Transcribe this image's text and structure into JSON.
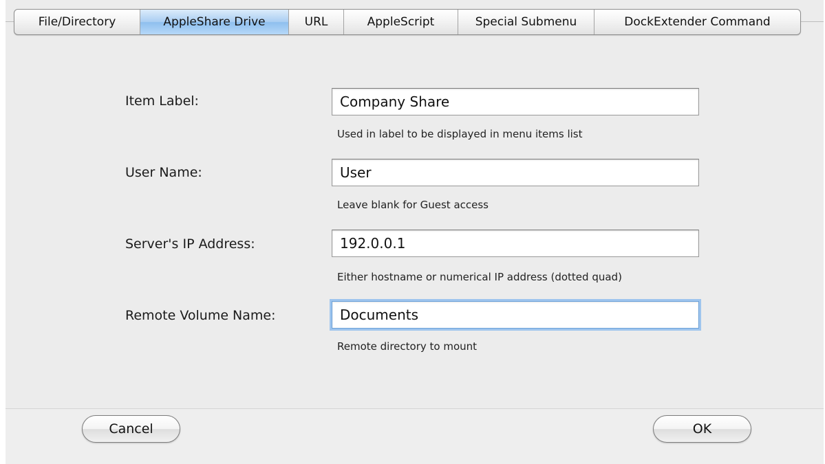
{
  "tabs": [
    {
      "label": "File/Directory",
      "selected": false
    },
    {
      "label": "AppleShare Drive",
      "selected": true
    },
    {
      "label": "URL",
      "selected": false
    },
    {
      "label": "AppleScript",
      "selected": false
    },
    {
      "label": "Special Submenu",
      "selected": false
    },
    {
      "label": "DockExtender Command",
      "selected": false
    }
  ],
  "form": {
    "item_label": {
      "label": "Item Label:",
      "value": "Company Share",
      "hint": "Used in label to be displayed in menu items list"
    },
    "user_name": {
      "label": "User Name:",
      "value": "User",
      "hint": "Leave blank for Guest access"
    },
    "server_ip": {
      "label": "Server's IP Address:",
      "value": "192.0.0.1",
      "hint": "Either hostname or numerical IP address (dotted quad)"
    },
    "remote_volume": {
      "label": "Remote Volume Name:",
      "value": "Documents",
      "hint": "Remote directory to mount"
    }
  },
  "buttons": {
    "cancel": "Cancel",
    "ok": "OK"
  },
  "colors": {
    "selected_tab": "#a9cdf2",
    "focus_ring": "#9fc5ee",
    "window_bg": "#ececec"
  }
}
